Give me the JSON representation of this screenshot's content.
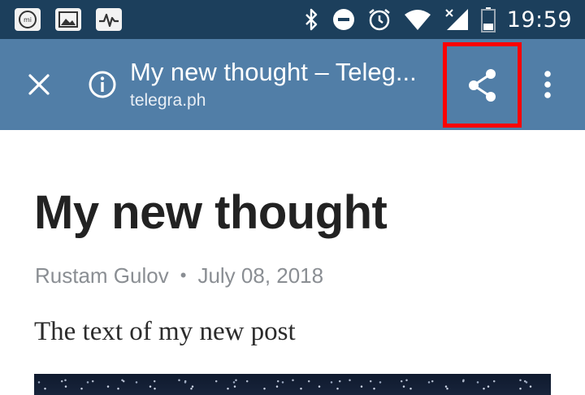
{
  "status_bar": {
    "time": "19:59",
    "left_icons": [
      "mi-app-icon",
      "gallery-icon",
      "activity-icon"
    ],
    "right_icons": [
      "bluetooth-icon",
      "do-not-disturb-icon",
      "alarm-icon",
      "wifi-icon",
      "signal-icon",
      "battery-icon"
    ]
  },
  "toolbar": {
    "title": "My new thought – Teleg...",
    "url": "telegra.ph",
    "close_icon": "close-icon",
    "info_icon": "info-icon",
    "share_icon": "share-icon",
    "more_icon": "more-vert-icon",
    "highlight_color": "#ff0000"
  },
  "article": {
    "title": "My new thought",
    "author": "Rustam Gulov",
    "separator": "•",
    "date": "July 08, 2018",
    "body": "The text of my new post"
  },
  "colors": {
    "status_bar": "#1c3f5c",
    "toolbar": "#517ea7",
    "title_text": "#222222",
    "meta_text": "#8a8e93"
  }
}
